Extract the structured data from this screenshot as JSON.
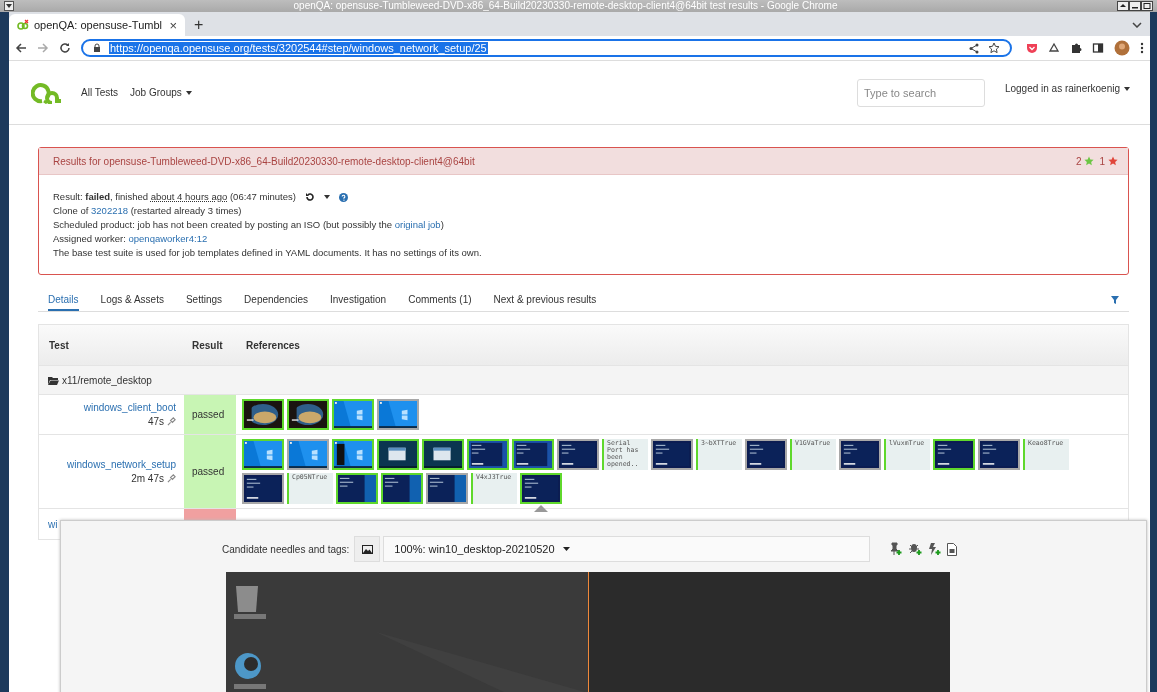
{
  "window": {
    "title": "openQA: opensuse-Tumbleweed-DVD-x86_64-Build20230330-remote-desktop-client4@64bit test results - Google Chrome"
  },
  "browser": {
    "tabs": [
      {
        "title": "openQA: opensuse-Tumbl",
        "close": "×",
        "selected": true
      }
    ],
    "new_tab": "+",
    "url": "https://openqa.opensuse.org/tests/3202544#step/windows_network_setup/25"
  },
  "nav": {
    "links": [
      {
        "label": "All Tests",
        "dropdown": false
      },
      {
        "label": "Job Groups",
        "dropdown": true
      }
    ],
    "search": {
      "placeholder": "Type to search"
    },
    "user": {
      "label": "Logged in as rainerkoenig",
      "dropdown": true
    }
  },
  "results": {
    "title": "Results for opensuse-Tumbleweed-DVD-x86_64-Build20230330-remote-desktop-client4@64bit",
    "stars": [
      {
        "count": "2",
        "color": "#6cc644"
      },
      {
        "count": "1",
        "color": "#e0453a"
      }
    ],
    "lines": [
      {
        "kind": "status",
        "parts": [
          {
            "kind": "text",
            "text": "Result: "
          },
          {
            "kind": "bold",
            "text": "failed"
          },
          {
            "kind": "text",
            "text": ", finished "
          },
          {
            "kind": "time",
            "text": "about 4 hours ago"
          },
          {
            "kind": "text",
            "text": " (06:47 minutes)"
          }
        ]
      },
      {
        "kind": "plain",
        "parts": [
          {
            "kind": "text",
            "text": "Clone of "
          },
          {
            "kind": "link",
            "text": "3202218"
          },
          {
            "kind": "text",
            "text": " (restarted already 3 times)"
          }
        ]
      },
      {
        "kind": "plain",
        "parts": [
          {
            "kind": "text",
            "text": "Scheduled product: job has not been created by posting an ISO (but possibly the "
          },
          {
            "kind": "link",
            "text": "original job"
          },
          {
            "kind": "text",
            "text": ")"
          }
        ]
      },
      {
        "kind": "plain",
        "parts": [
          {
            "kind": "text",
            "text": "Assigned worker: "
          },
          {
            "kind": "link",
            "text": "openqaworker4:12"
          }
        ]
      },
      {
        "kind": "plain",
        "parts": [
          {
            "kind": "text",
            "text": "The base test suite is used for job templates defined in YAML documents. It has no settings of its own."
          }
        ]
      }
    ]
  },
  "tabs": [
    {
      "label": "Details",
      "selected": true
    },
    {
      "label": "Logs & Assets",
      "selected": false
    },
    {
      "label": "Settings",
      "selected": false
    },
    {
      "label": "Dependencies",
      "selected": false
    },
    {
      "label": "Investigation",
      "selected": false
    },
    {
      "label": "Comments (1)",
      "selected": false
    },
    {
      "label": "Next & previous results",
      "selected": false
    }
  ],
  "table": {
    "columns": [
      "Test",
      "Result",
      "References"
    ],
    "group": "x11/remote_desktop",
    "rows": [
      {
        "name": "windows_client_boot",
        "duration": "47s",
        "result": "passed",
        "kind": "passed",
        "references": [
          {
            "kind": "picture",
            "matched": true,
            "selected": false
          },
          {
            "kind": "picture",
            "matched": true,
            "selected": false
          },
          {
            "kind": "picture",
            "matched": true,
            "selected": false
          },
          {
            "kind": "picture",
            "matched": false,
            "selected": false
          }
        ]
      },
      {
        "name": "windows_network_setup",
        "duration": "2m 47s",
        "result": "passed",
        "kind": "passed",
        "references": [
          {
            "kind": "picture",
            "matched": true,
            "selected": false
          },
          {
            "kind": "picture",
            "matched": false,
            "selected": false
          },
          {
            "kind": "picture",
            "matched": true,
            "selected": false
          },
          {
            "kind": "picture",
            "matched": true,
            "selected": false
          },
          {
            "kind": "picture",
            "matched": true,
            "selected": false
          },
          {
            "kind": "picture",
            "matched": true,
            "selected": false
          },
          {
            "kind": "picture",
            "matched": true,
            "selected": false
          },
          {
            "kind": "picture",
            "matched": false,
            "selected": false
          },
          {
            "kind": "text",
            "text": "Serial Port has been opened..",
            "selected": false
          },
          {
            "kind": "picture",
            "matched": false,
            "selected": false
          },
          {
            "kind": "text",
            "text": "3~bXTTrue",
            "selected": false
          },
          {
            "kind": "picture",
            "matched": false,
            "selected": false
          },
          {
            "kind": "text",
            "text": "V1GVaTrue",
            "selected": false
          },
          {
            "kind": "picture",
            "matched": false,
            "selected": false
          },
          {
            "kind": "text",
            "text": "lVuxmTrue",
            "selected": false
          },
          {
            "kind": "picture",
            "matched": true,
            "selected": false
          },
          {
            "kind": "picture",
            "matched": false,
            "selected": false
          },
          {
            "kind": "text",
            "text": "Keao8True",
            "selected": false
          },
          {
            "kind": "picture",
            "matched": false,
            "selected": false
          },
          {
            "kind": "text",
            "text": "Cp05NTrue",
            "selected": false
          },
          {
            "kind": "picture",
            "matched": true,
            "selected": false
          },
          {
            "kind": "picture",
            "matched": true,
            "selected": false
          },
          {
            "kind": "picture",
            "matched": false,
            "selected": false
          },
          {
            "kind": "text",
            "text": "V4xJ3True",
            "selected": false
          },
          {
            "kind": "picture",
            "matched": true,
            "selected": true
          }
        ]
      },
      {
        "name": "wi",
        "kind": "failed"
      }
    ]
  },
  "needle_panel": {
    "label": "Candidate needles and tags:",
    "selection": "100%: win10_desktop-20210520"
  }
}
